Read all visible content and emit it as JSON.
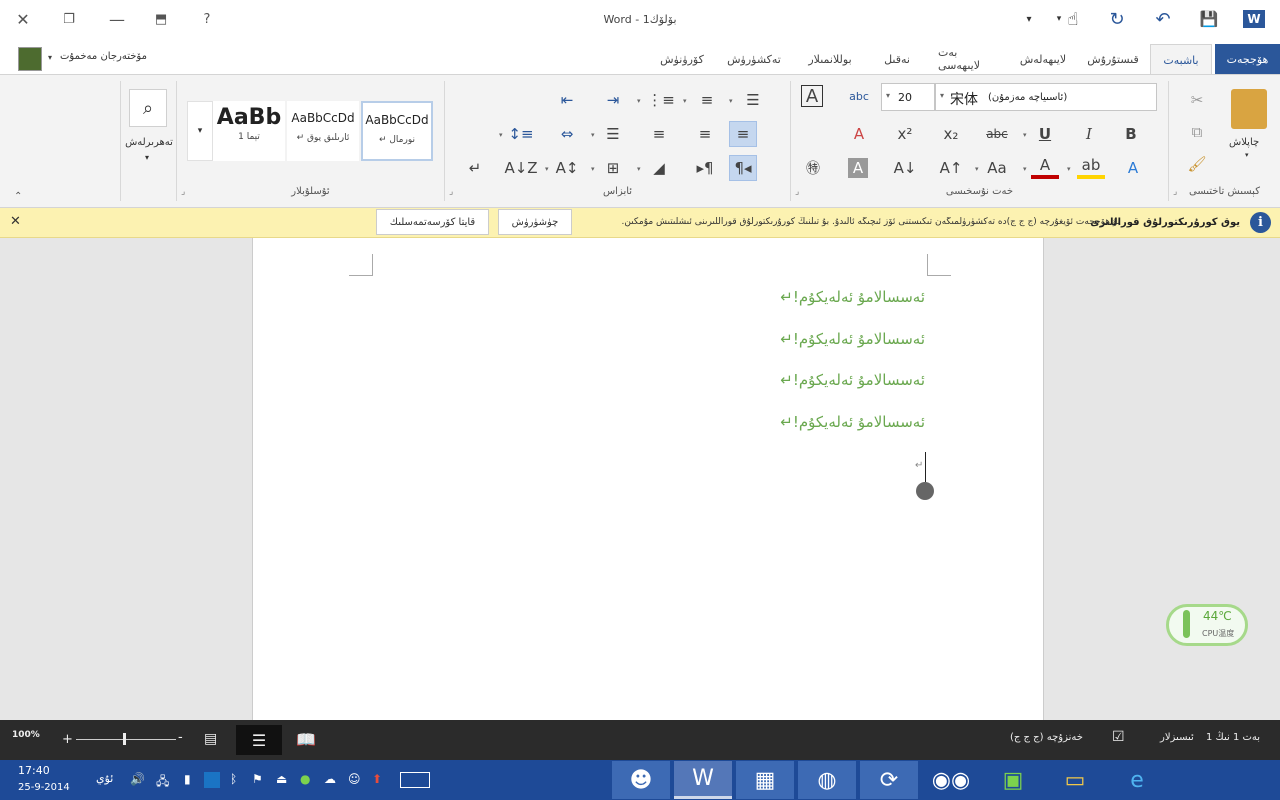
{
  "window": {
    "title": "Word - بۆلۆك1",
    "controls": {
      "close": "✕",
      "restore": "❐",
      "minimize": "—",
      "ribbon_display": "⬒",
      "help": "?"
    }
  },
  "qat": {
    "word": "W",
    "save": "💾",
    "undo": "↶",
    "redo": "↻",
    "touch": "☝"
  },
  "user": {
    "name": "مۆختەرجان مەخمۇت"
  },
  "tabs": [
    "ھۆججەت",
    "باشبەت",
    "قىستۇرۇش",
    "لايىھەلەش",
    "بەت لايىھەسى",
    "نەقىل",
    "بوللانمىلار",
    "تەكشۈرۈش",
    "كۆرۈنۈش"
  ],
  "ribbon": {
    "clipboard": {
      "paste": "چاپلاش",
      "group": "كېسىش تاختىسى"
    },
    "font": {
      "font_name": "宋体",
      "font_name_hint": "(ئاسىياچە مەزمۇن)",
      "font_size": "20",
      "group": "خەت نۇسخىسى"
    },
    "paragraph": {
      "group": "ئابزاس"
    },
    "styles": {
      "group": "ئۇسلۇبلار",
      "items": [
        {
          "sample": "AaBbCcDd",
          "name": "↵ نورمال"
        },
        {
          "sample": "AaBbCcDd",
          "name": "↵ ئارىلىق يوق"
        },
        {
          "sample": "AaBb",
          "name": "تېما 1"
        }
      ]
    },
    "editing": {
      "find": "تەھرىرلەش"
    }
  },
  "message_bar": {
    "title": "يوق كورۇرىكتورلۇق قوراللىرى",
    "text": "بۇ ھۆججەت ئۆيغۇرچە (ج ج ج)دە تەكشۈرۈلمىگەن تىكىستنى ئۆز ئىچىگە ئالىدۇ. بۇ تىلنىڭ كورۇرىكتورلۇق قوراللىرىنى ئىشلىتىش مۇمكىن.",
    "btn_check": "چۈشۈرۈش",
    "btn_dont_show": "قايتا كۆرسەتمەسلىك"
  },
  "document": {
    "paragraphs": [
      "ئەسسالامۇ ئەلەيكۇم!↵",
      "ئەسسالامۇ ئەلەيكۇم!↵",
      "ئەسسالامۇ ئەلەيكۇم!↵",
      "ئەسسالامۇ ئەلەيكۇم!↵"
    ],
    "empty_mark": "↵"
  },
  "widget": {
    "temp": "44℃",
    "label": "CPU温度"
  },
  "status": {
    "page": "بەت 1 نىڭ 1",
    "words": "ئىسىزلار",
    "language": "خەنزۇچە (ج ج ج)",
    "zoom": "100%"
  },
  "taskbar": {
    "time": "17:40",
    "date": "25-9-2014",
    "lang": "ئۇي"
  },
  "colors": {
    "accent": "#2b579a",
    "doc_text": "#6aa84f",
    "message_bg": "#fcf2b1"
  }
}
